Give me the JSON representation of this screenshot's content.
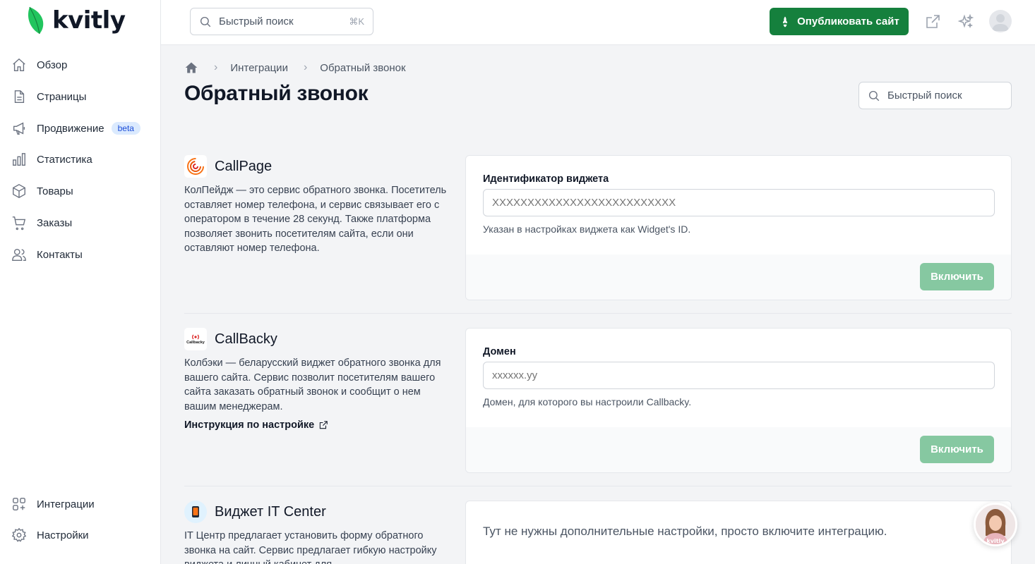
{
  "brand": {
    "name": "kvitly",
    "accent": "#15803d",
    "leaf_color": "#22c55e"
  },
  "sidebar": {
    "items": [
      {
        "label": "Обзор",
        "icon": "home-icon"
      },
      {
        "label": "Страницы",
        "icon": "document-icon"
      },
      {
        "label": "Продвижение",
        "icon": "megaphone-icon",
        "badge": "beta"
      },
      {
        "label": "Статистика",
        "icon": "bar-chart-icon"
      },
      {
        "label": "Товары",
        "icon": "cube-icon"
      },
      {
        "label": "Заказы",
        "icon": "cart-icon"
      },
      {
        "label": "Контакты",
        "icon": "users-icon"
      }
    ],
    "bottom_items": [
      {
        "label": "Интеграции",
        "icon": "grid-plus-icon"
      },
      {
        "label": "Настройки",
        "icon": "gear-icon"
      }
    ]
  },
  "topbar": {
    "search_placeholder": "Быстрый поиск",
    "search_shortcut": "⌘K",
    "publish_label": "Опубликовать сайт"
  },
  "breadcrumb": {
    "items": [
      "Интеграции",
      "Обратный звонок"
    ]
  },
  "page": {
    "title": "Обратный звонок",
    "search_placeholder": "Быстрый поиск"
  },
  "integrations": [
    {
      "name": "CallPage",
      "description": "КолПейдж — это сервис обратного звонка. Посетитель оставляет номер телефона, и сервис связывает его с оператором в течение 28 секунд. Также платформа позволяет звонить посетителям сайта, если они оставляют номер телефона.",
      "field_label": "Идентификатор виджета",
      "field_placeholder": "XXXXXXXXXXXXXXXXXXXXXXXXXX",
      "hint": "Указан в настройках виджета как Widget's ID.",
      "button": "Включить"
    },
    {
      "name": "CallBacky",
      "logo_text": "Callbacky",
      "description": "Колбэки — беларусский виджет обратного звонка для вашего сайта. Сервис позволит посетителям вашего сайта заказать обратный звонок и сообщит о нем вашим менеджерам.",
      "link": "Инструкция по настройке",
      "field_label": "Домен",
      "field_placeholder": "xxxxxx.yy",
      "hint": "Домен, для которого вы настроили Callbacky.",
      "button": "Включить"
    },
    {
      "name": "Виджет IT Center",
      "description": "IT Центр предлагает установить форму обратного звонка на сайт. Сервис предлагает гибкую настройку виджета и личный кабинет для",
      "note": "Тут не нужны дополнительные настройки, просто включите интеграцию."
    }
  ],
  "chat": {
    "label": "kvitly"
  }
}
